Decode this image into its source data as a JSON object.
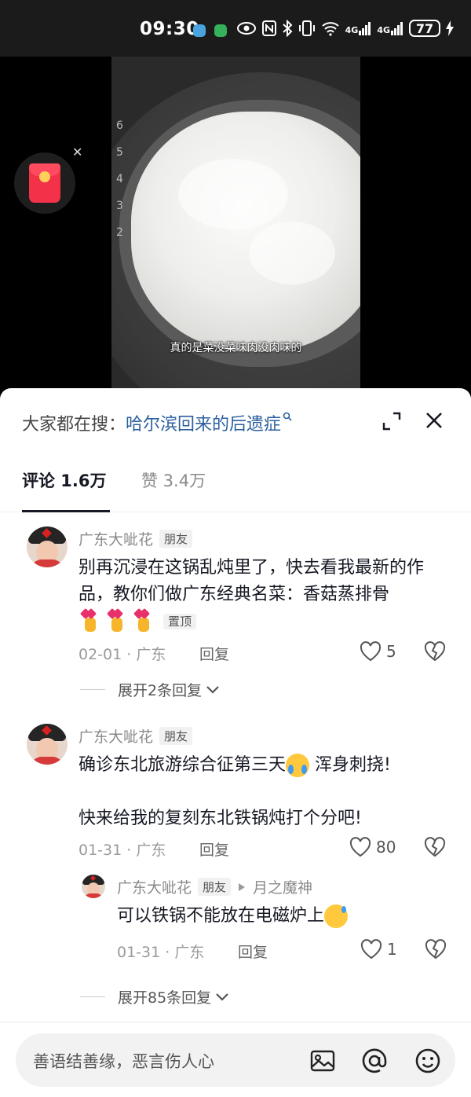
{
  "status_bar": {
    "time": "09:30",
    "battery": "77",
    "network_1": "4G",
    "network_2": "4G"
  },
  "video": {
    "subtitle": "真的是菜没菜味肉没肉味的",
    "scale_marks": [
      "6",
      "5",
      "4",
      "3",
      "2"
    ]
  },
  "hot_search": {
    "label": "大家都在搜：",
    "keyword": "哈尔滨回来的后遗症"
  },
  "tabs": {
    "comments": "评论 1.6万",
    "likes": "赞 3.4万"
  },
  "comments": [
    {
      "user": "广东大呲花",
      "badge": "朋友",
      "text": "别再沉浸在这锅乱炖里了，快去看我最新的作品，教你们做广东经典名菜：香菇蒸排骨",
      "pinned_label": "置顶",
      "date_loc": "02-01 · 广东",
      "reply_label": "回复",
      "likes": "5",
      "expand_label": "展开2条回复"
    },
    {
      "user": "广东大呲花",
      "badge": "朋友",
      "text_1": "确诊东北旅游综合征第三天",
      "text_2": " 浑身刺挠!",
      "text_3": "快来给我的复刻东北铁锅炖打个分吧!",
      "date_loc": "01-31 · 广东",
      "reply_label": "回复",
      "likes": "80",
      "reply": {
        "user": "广东大呲花",
        "badge": "朋友",
        "reply_to": "月之魔神",
        "text": "可以铁锅不能放在电磁炉上",
        "date_loc": "01-31 · 广东",
        "reply_label": "回复",
        "likes": "1"
      },
      "expand_label": "展开85条回复"
    }
  ],
  "input": {
    "placeholder": "善语结善缘，恶言伤人心"
  },
  "icons": {
    "expand": "expand-icon",
    "close": "close-icon",
    "image": "image-icon",
    "at": "at-icon",
    "emoji": "emoji-icon",
    "heart": "heart-icon",
    "broken_heart": "broken-heart-icon"
  }
}
